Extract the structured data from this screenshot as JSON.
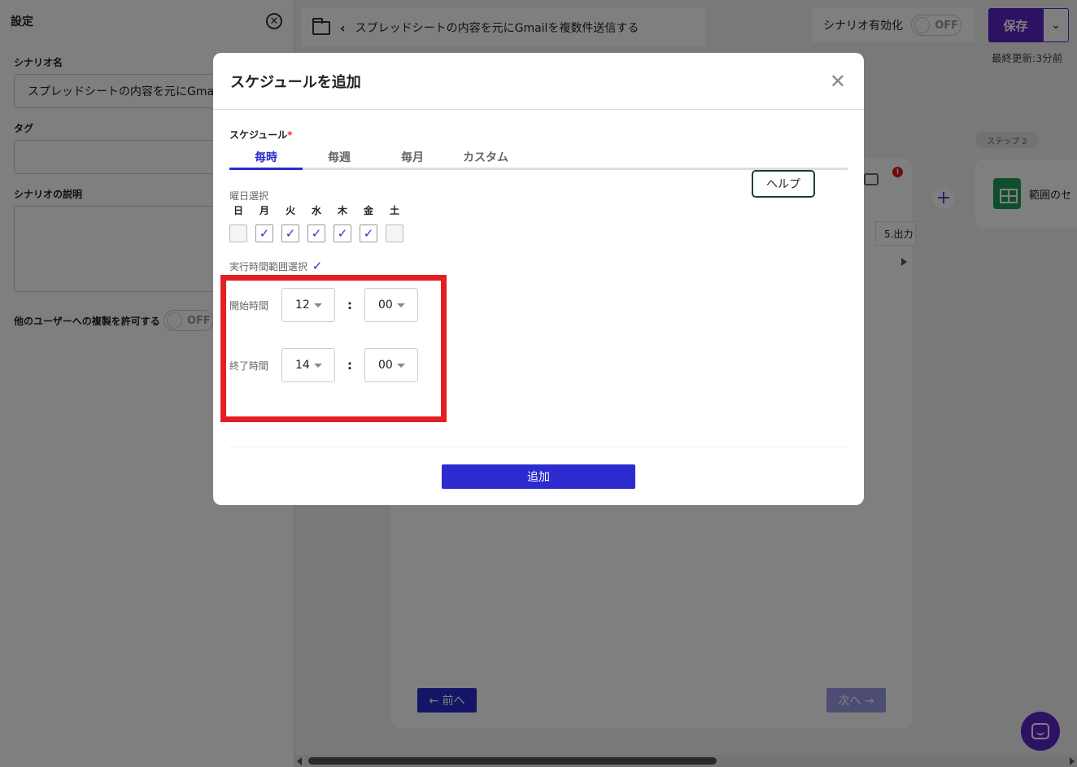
{
  "left_panel": {
    "title": "設定",
    "scenario_name_label": "シナリオ名",
    "scenario_name_value": "スプレッドシートの内容を元にGmail",
    "tag_label": "タグ",
    "description_label": "シナリオの説明",
    "allow_copy_label": "他のユーザーへの複製を許可する",
    "allow_copy_state": "OFF"
  },
  "topbar": {
    "breadcrumb": "スプレッドシートの内容を元にGmailを複数件送信する",
    "enable_label": "シナリオ有効化",
    "enable_state": "OFF",
    "save_label": "保存",
    "last_updated": "最終更新:3分前"
  },
  "canvas": {
    "step_badge": "ステップ 2",
    "step_card_label": "範囲のセ",
    "output_chip": "5.出力",
    "prev_label": "← 前へ",
    "next_label": "次へ →"
  },
  "modal": {
    "title": "スケジュールを追加",
    "schedule_label": "スケジュール",
    "required_mark": "*",
    "tabs": [
      {
        "label": "毎時",
        "active": true
      },
      {
        "label": "毎週",
        "active": false
      },
      {
        "label": "毎月",
        "active": false
      },
      {
        "label": "カスタム",
        "active": false
      }
    ],
    "help_label": "ヘルプ",
    "weekday_label": "曜日選択",
    "weekdays": [
      {
        "name": "日",
        "checked": false
      },
      {
        "name": "月",
        "checked": true
      },
      {
        "name": "火",
        "checked": true
      },
      {
        "name": "水",
        "checked": true
      },
      {
        "name": "木",
        "checked": true
      },
      {
        "name": "金",
        "checked": true
      },
      {
        "name": "土",
        "checked": false
      }
    ],
    "time_range_label": "実行時間範囲選択",
    "time_range_checked": true,
    "start_label": "開始時間",
    "start_hour": "12",
    "start_minute": "00",
    "end_label": "終了時間",
    "end_hour": "14",
    "end_minute": "00",
    "colon": ":",
    "add_label": "追加"
  },
  "colors": {
    "accent": "#2b2bd0",
    "brand": "#5a22c7",
    "highlight": "#e31e24"
  }
}
